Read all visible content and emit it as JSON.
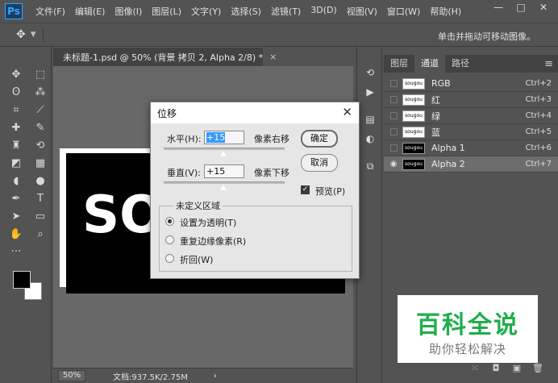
{
  "app": {
    "logo": "Ps",
    "menu": [
      "文件(F)",
      "编辑(E)",
      "图像(I)",
      "图层(L)",
      "文字(Y)",
      "选择(S)",
      "滤镜(T)",
      "3D(D)",
      "视图(V)",
      "窗口(W)",
      "帮助(H)"
    ],
    "window_controls": [
      "—",
      "□",
      "✕"
    ]
  },
  "options_bar": {
    "move_icon": "move-icon",
    "hint": "单击并拖动可移动图像。"
  },
  "document": {
    "tab_title": "未标题-1.psd @ 50% (背景 拷贝 2, Alpha 2/8) *",
    "close": "×",
    "canvas_text": "SO",
    "zoom": "50%",
    "doc_info": "文档:937.5K/2.75M",
    "status_arrow": "›"
  },
  "toolbar": {
    "tools": [
      {
        "name": "move-tool-icon",
        "glyph": "✥"
      },
      {
        "name": "marquee-tool-icon",
        "glyph": "⬚"
      },
      {
        "name": "lasso-tool-icon",
        "glyph": "ʘ"
      },
      {
        "name": "magic-wand-tool-icon",
        "glyph": "⁂"
      },
      {
        "name": "crop-tool-icon",
        "glyph": "⌗"
      },
      {
        "name": "eyedropper-tool-icon",
        "glyph": "⟋"
      },
      {
        "name": "healing-brush-tool-icon",
        "glyph": "✚"
      },
      {
        "name": "brush-tool-icon",
        "glyph": "✎"
      },
      {
        "name": "clone-stamp-tool-icon",
        "glyph": "♜"
      },
      {
        "name": "history-brush-tool-icon",
        "glyph": "⟲"
      },
      {
        "name": "eraser-tool-icon",
        "glyph": "◩"
      },
      {
        "name": "gradient-tool-icon",
        "glyph": "▦"
      },
      {
        "name": "blur-tool-icon",
        "glyph": "◖"
      },
      {
        "name": "dodge-tool-icon",
        "glyph": "●"
      },
      {
        "name": "pen-tool-icon",
        "glyph": "✒"
      },
      {
        "name": "type-tool-icon",
        "glyph": "T"
      },
      {
        "name": "path-selection-tool-icon",
        "glyph": "➤"
      },
      {
        "name": "rectangle-tool-icon",
        "glyph": "▭"
      },
      {
        "name": "hand-tool-icon",
        "glyph": "✋"
      },
      {
        "name": "zoom-tool-icon",
        "glyph": "⌕"
      },
      {
        "name": "more-tools-icon",
        "glyph": "···"
      },
      {
        "name": "blank-icon",
        "glyph": ""
      }
    ]
  },
  "channels_panel": {
    "tabs": [
      "图层",
      "通道",
      "路径"
    ],
    "active_tab": 1,
    "menu_icon": "≡",
    "thumb_text": "sougou",
    "channels": [
      {
        "name": "RGB",
        "shortcut": "Ctrl+2",
        "thumb": "light",
        "visible": false,
        "selected": false
      },
      {
        "name": "红",
        "shortcut": "Ctrl+3",
        "thumb": "light",
        "visible": false,
        "selected": false
      },
      {
        "name": "绿",
        "shortcut": "Ctrl+4",
        "thumb": "light",
        "visible": false,
        "selected": false
      },
      {
        "name": "蓝",
        "shortcut": "Ctrl+5",
        "thumb": "light",
        "visible": false,
        "selected": false
      },
      {
        "name": "Alpha 1",
        "shortcut": "Ctrl+6",
        "thumb": "dark",
        "visible": false,
        "selected": false
      },
      {
        "name": "Alpha 2",
        "shortcut": "Ctrl+7",
        "thumb": "dark",
        "visible": true,
        "selected": true
      }
    ],
    "bottom_icons": [
      "⁙",
      "◘",
      "▣",
      "🗑"
    ]
  },
  "offset_dialog": {
    "title": "位移",
    "close": "✕",
    "horizontal_label": "水平(H):",
    "horizontal_value": "+15",
    "horizontal_unit": "像素右移",
    "vertical_label": "垂直(V):",
    "vertical_value": "+15",
    "vertical_unit": "像素下移",
    "ok": "确定",
    "cancel": "取消",
    "preview_label": "预览(P)",
    "preview_checked": true,
    "group_title": "未定义区域",
    "options": [
      {
        "label": "设置为透明(T)",
        "checked": true
      },
      {
        "label": "重复边缘像素(R)",
        "checked": false
      },
      {
        "label": "折回(W)",
        "checked": false
      }
    ]
  },
  "watermark": {
    "title": "百科全说",
    "subtitle": "助你轻松解决"
  },
  "colors": {
    "ui_bg": "#535353",
    "canvas_bg": "#686868",
    "selected_row": "#6d6d6d",
    "watermark_green": "#1fae4b",
    "selection_blue": "#3399ff"
  }
}
